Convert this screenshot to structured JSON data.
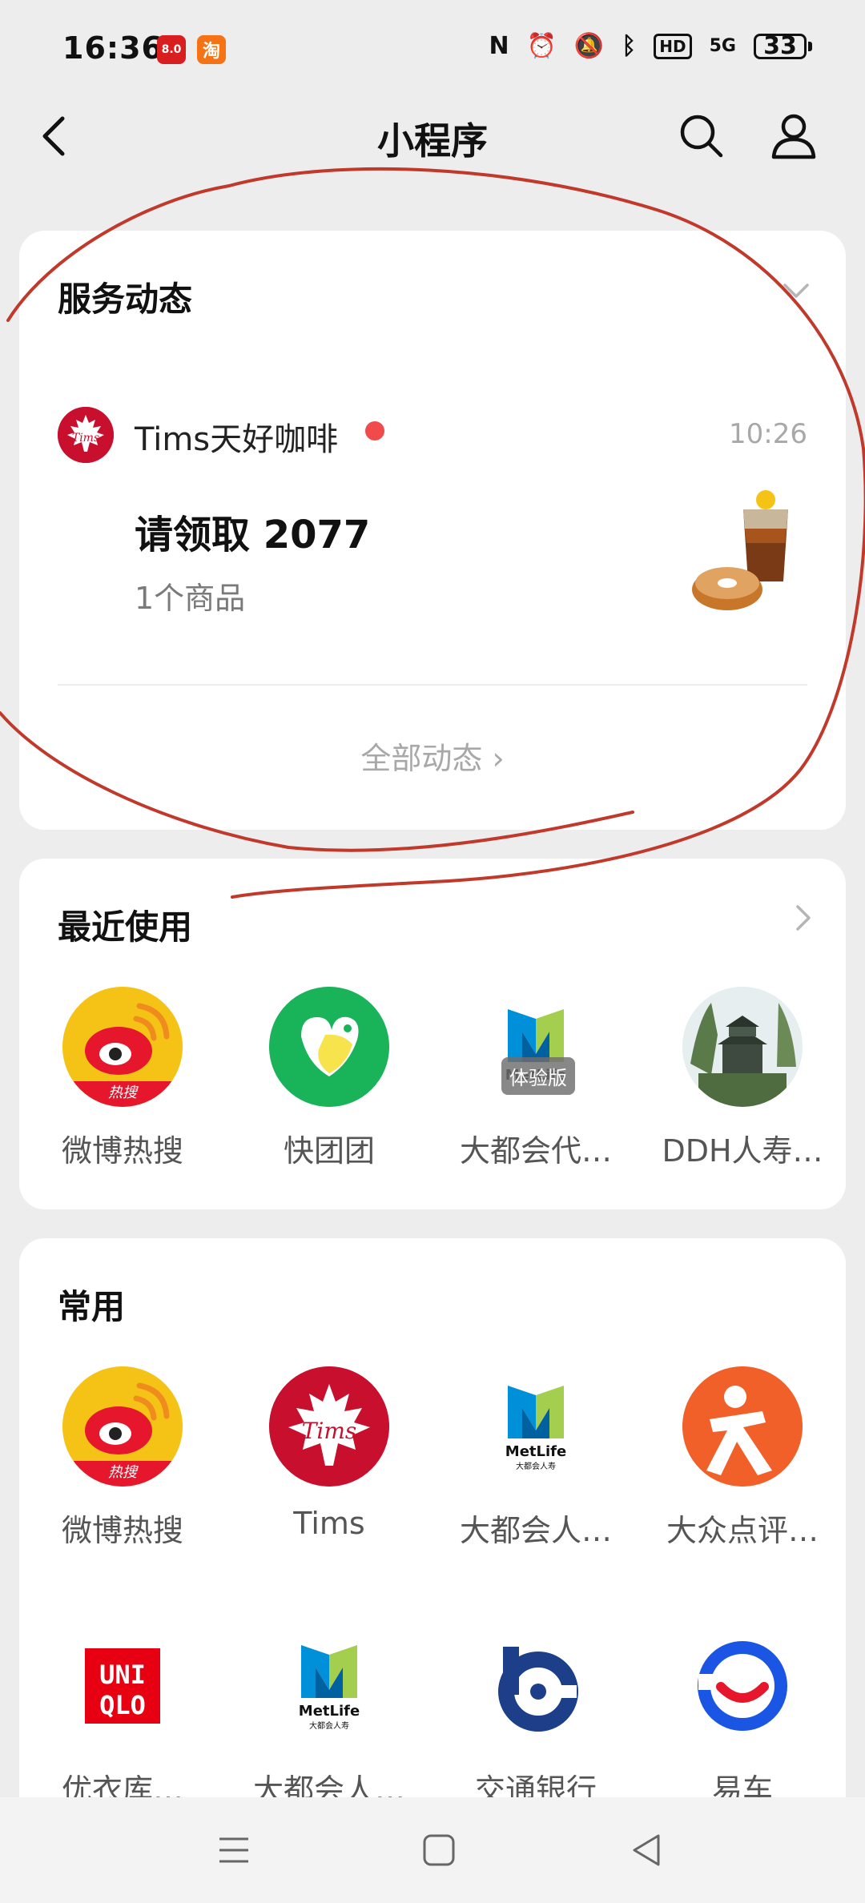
{
  "status_bar": {
    "time": "16:36",
    "badge_1": "8.0",
    "badge_2": "淘",
    "hd": "HD",
    "signal": "5G",
    "battery": "33"
  },
  "nav": {
    "title": "小程序"
  },
  "service_card": {
    "title": "服务动态",
    "item": {
      "name": "Tims天好咖啡",
      "time": "10:26",
      "headline": "请领取 2077",
      "subtitle": "1个商品"
    },
    "all_link": "全部动态 ›"
  },
  "recent_card": {
    "title": "最近使用",
    "apps": [
      {
        "label": "微博热搜",
        "icon": "weibo-hot-icon"
      },
      {
        "label": "快团团",
        "icon": "kuaituantuan-icon"
      },
      {
        "label": "大都会代…",
        "icon": "metlife-icon"
      },
      {
        "label": "DDH人寿…",
        "icon": "castle-photo-icon"
      }
    ],
    "trial_badge": "体验版"
  },
  "common_card": {
    "title": "常用",
    "apps_row1": [
      {
        "label": "微博热搜",
        "icon": "weibo-hot-icon"
      },
      {
        "label": "Tims",
        "icon": "tims-icon"
      },
      {
        "label": "大都会人…",
        "icon": "metlife-icon"
      },
      {
        "label": "大众点评…",
        "icon": "dianping-icon"
      }
    ],
    "apps_row2": [
      {
        "label": "优衣库…",
        "icon": "uniqlo-icon"
      },
      {
        "label": "大都会人…",
        "icon": "metlife-icon"
      },
      {
        "label": "交通银行",
        "icon": "bocom-icon"
      },
      {
        "label": "易车",
        "icon": "yiche-icon"
      }
    ]
  },
  "logo_text": {
    "tims": "Tims",
    "weibo_hot": "热搜",
    "metlife": "MetLife",
    "metlife_sub": "大都会人寿",
    "uniqlo_top": "UNI",
    "uniqlo_bottom": "QLO"
  },
  "colors": {
    "background": "#ededed",
    "card": "#ffffff",
    "tims_red": "#c8102e",
    "unread_dot": "#f04a4a",
    "annotation_red": "#c0392b",
    "weibo_yellow": "#f5c316",
    "kuaituantuan_green": "#19b35a",
    "dianping_orange": "#f2602a",
    "yiche_blue": "#1a55e3",
    "bocom_blue": "#1d3f8a"
  }
}
